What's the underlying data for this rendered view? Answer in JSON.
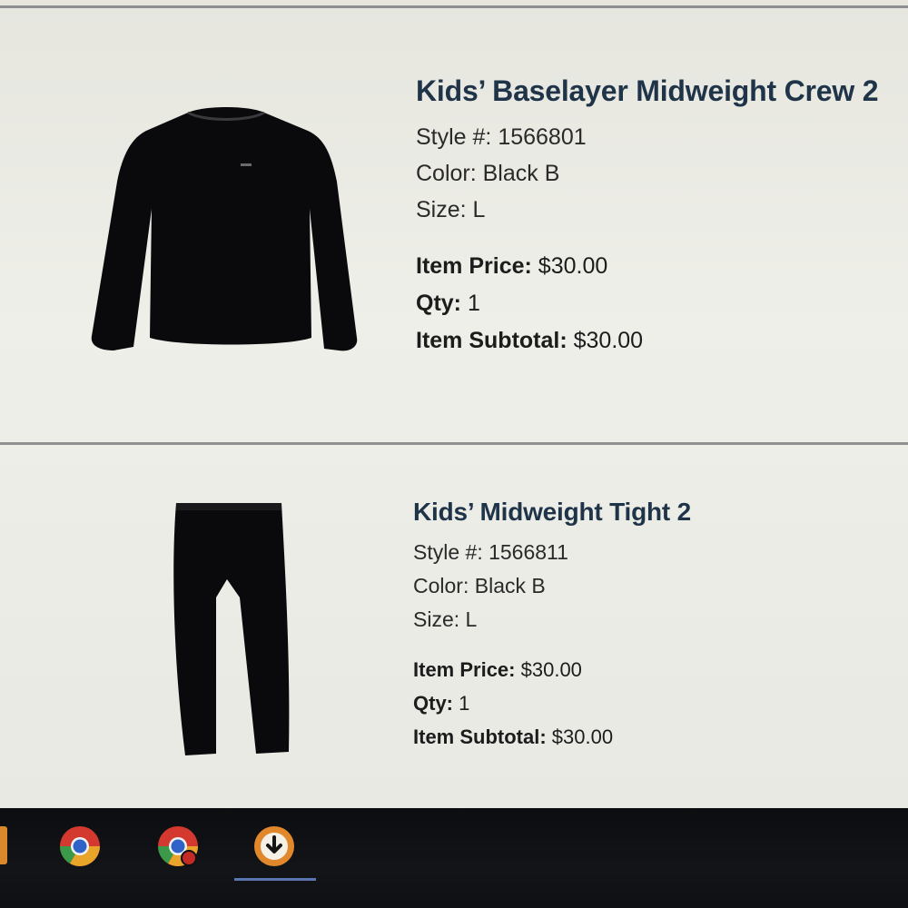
{
  "items": [
    {
      "title": "Kids’ Baselayer Midweight Crew 2",
      "style": "Style #: 1566801",
      "color": "Color: Black B",
      "size": "Size: L",
      "price_label": "Item Price:",
      "price_value": "$30.00",
      "qty_label": "Qty:",
      "qty_value": "1",
      "subtotal_label": "Item Subtotal:",
      "subtotal_value": "$30.00",
      "image_icon": "long-sleeve-shirt-icon"
    },
    {
      "title": "Kids’ Midweight Tight 2",
      "style": "Style #: 1566811",
      "color": "Color: Black B",
      "size": "Size: L",
      "price_label": "Item Price:",
      "price_value": "$30.00",
      "qty_label": "Qty:",
      "qty_value": "1",
      "subtotal_label": "Item Subtotal:",
      "subtotal_value": "$30.00",
      "image_icon": "tights-icon"
    }
  ],
  "taskbar": {
    "icons": [
      "chrome-icon",
      "chrome-profile-icon",
      "download-icon"
    ]
  },
  "colors": {
    "title": "#1f3448",
    "background": "#ecece6",
    "garment": "#0a0a0c",
    "taskbar": "#0e1014"
  }
}
